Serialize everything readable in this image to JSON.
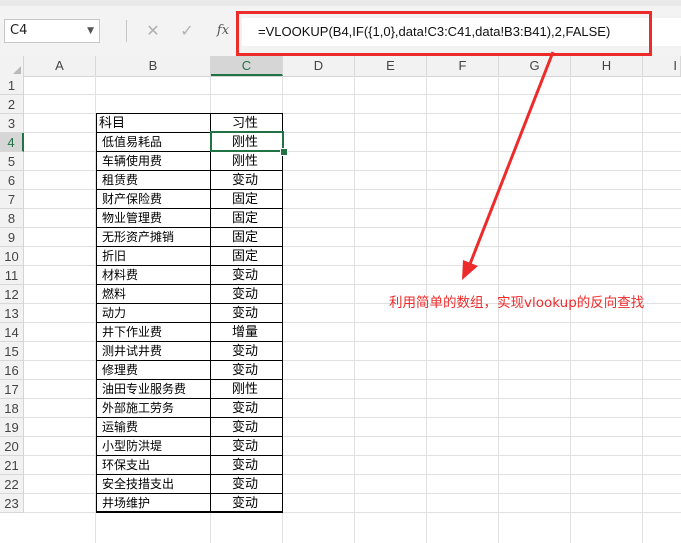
{
  "formula_bar": {
    "name_box": "C4",
    "cancel_glyph": "✕",
    "enter_glyph": "✓",
    "fx_label": "fx",
    "formula": "=VLOOKUP(B4,IF({1,0},data!C3:C41,data!B3:B41),2,FALSE)"
  },
  "columns": [
    "A",
    "B",
    "C",
    "D",
    "E",
    "F",
    "G",
    "H",
    "I"
  ],
  "rows": [
    "1",
    "2",
    "3",
    "4",
    "5",
    "6",
    "7",
    "8",
    "9",
    "10",
    "11",
    "12",
    "13",
    "14",
    "15",
    "16",
    "17",
    "18",
    "19",
    "20",
    "21",
    "22",
    "23"
  ],
  "table": {
    "header": {
      "subject": "科目",
      "habit": "习性"
    },
    "rows": [
      {
        "subject": "低值易耗品",
        "habit": "刚性"
      },
      {
        "subject": "车辆使用费",
        "habit": "刚性"
      },
      {
        "subject": "租赁费",
        "habit": "变动"
      },
      {
        "subject": "财产保险费",
        "habit": "固定"
      },
      {
        "subject": "物业管理费",
        "habit": "固定"
      },
      {
        "subject": "无形资产摊销",
        "habit": "固定"
      },
      {
        "subject": "折旧",
        "habit": "固定"
      },
      {
        "subject": "材料费",
        "habit": "变动"
      },
      {
        "subject": "燃料",
        "habit": "变动"
      },
      {
        "subject": "动力",
        "habit": "变动"
      },
      {
        "subject": "井下作业费",
        "habit": "增量"
      },
      {
        "subject": "测井试井费",
        "habit": "变动"
      },
      {
        "subject": "修理费",
        "habit": "变动"
      },
      {
        "subject": "油田专业服务费",
        "habit": "刚性"
      },
      {
        "subject": "外部施工劳务",
        "habit": "变动"
      },
      {
        "subject": "运输费",
        "habit": "变动"
      },
      {
        "subject": "小型防洪堤",
        "habit": "变动"
      },
      {
        "subject": "环保支出",
        "habit": "变动"
      },
      {
        "subject": "安全技措支出",
        "habit": "变动"
      },
      {
        "subject": "井场维护",
        "habit": "变动"
      }
    ]
  },
  "annotation": "利用简单的数组，实现vlookup的反向查找",
  "colors": {
    "accent_green": "#217346",
    "callout_red": "#ee2b2b"
  }
}
